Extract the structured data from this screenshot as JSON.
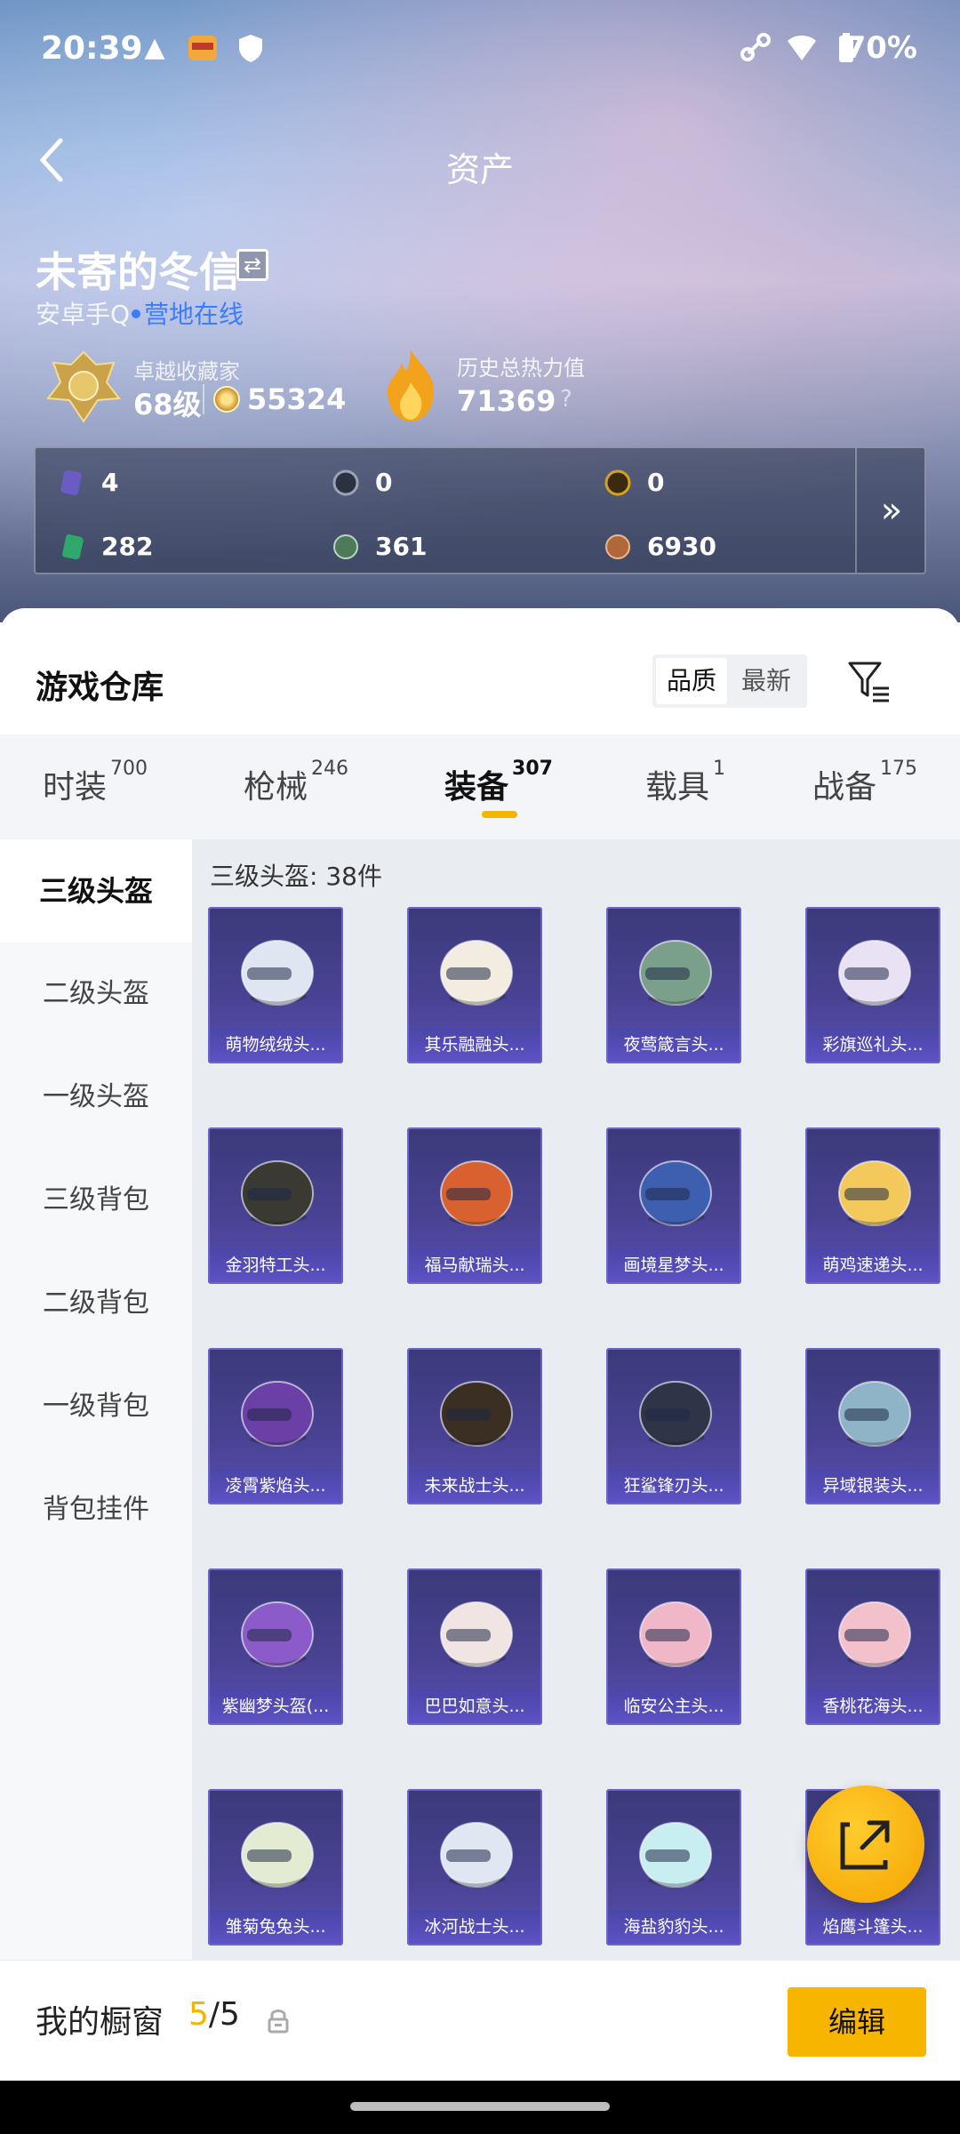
{
  "status_bar": {
    "time": "20:39",
    "battery": "70%"
  },
  "nav": {
    "title": "资产"
  },
  "player": {
    "name": "未寄的冬信",
    "platform": "安卓手Q",
    "status": "营地在线",
    "rank_title": "卓越收藏家",
    "level": "68级",
    "coins": "55324",
    "heat_title": "历史总热力值",
    "heat_value": "71369",
    "heat_help": "?"
  },
  "currencies": [
    {
      "icon": "card-icon",
      "value": "4",
      "color": "#6b5cc4"
    },
    {
      "icon": "ticket-icon",
      "value": "0",
      "color": "#7a8291"
    },
    {
      "icon": "gold-coin-icon",
      "value": "0",
      "color": "#d6a21e"
    },
    {
      "icon": "green-card-icon",
      "value": "282",
      "color": "#2fa86b"
    },
    {
      "icon": "green-orb-icon",
      "value": "361",
      "color": "#4f7a5a"
    },
    {
      "icon": "bronze-coin-icon",
      "value": "6930",
      "color": "#b0683a"
    }
  ],
  "warehouse": {
    "title": "游戏仓库",
    "sort_quality": "品质",
    "sort_newest": "最新"
  },
  "tabs": [
    {
      "label": "时装",
      "count": "700"
    },
    {
      "label": "枪械",
      "count": "246"
    },
    {
      "label": "装备",
      "count": "307"
    },
    {
      "label": "载具",
      "count": "1"
    },
    {
      "label": "战备",
      "count": "175"
    }
  ],
  "sidebar": {
    "items": [
      {
        "label": "三级头盔"
      },
      {
        "label": "二级头盔"
      },
      {
        "label": "一级头盔"
      },
      {
        "label": "三级背包"
      },
      {
        "label": "二级背包"
      },
      {
        "label": "一级背包"
      },
      {
        "label": "背包挂件"
      }
    ]
  },
  "content": {
    "section_label": "三级头盔: 38件",
    "items": [
      {
        "name": "萌物绒绒头...",
        "color": "#dfe6f2"
      },
      {
        "name": "其乐融融头...",
        "color": "#f3ece0"
      },
      {
        "name": "夜莺箴言头...",
        "color": "#7aa08b"
      },
      {
        "name": "彩旗巡礼头...",
        "color": "#e9e2f4"
      },
      {
        "name": "金羽特工头...",
        "color": "#3a3a33"
      },
      {
        "name": "福马献瑞头...",
        "color": "#d9612f"
      },
      {
        "name": "画境星梦头...",
        "color": "#3e5fb0"
      },
      {
        "name": "萌鸡速递头...",
        "color": "#f2c95a"
      },
      {
        "name": "凌霄紫焰头...",
        "color": "#6a3fa6"
      },
      {
        "name": "未来战士头...",
        "color": "#3b2e22"
      },
      {
        "name": "狂鲨锋刃头...",
        "color": "#2f3547"
      },
      {
        "name": "异域银装头...",
        "color": "#8fb4c8"
      },
      {
        "name": "紫幽梦头盔(...",
        "color": "#8a5bc9"
      },
      {
        "name": "巴巴如意头...",
        "color": "#f1e5e3"
      },
      {
        "name": "临安公主头...",
        "color": "#f0b7c8"
      },
      {
        "name": "香桃花海头...",
        "color": "#f3c1cc"
      },
      {
        "name": "雏菊兔兔头...",
        "color": "#e3ecd2"
      },
      {
        "name": "冰河战士头...",
        "color": "#dfe7f3"
      },
      {
        "name": "海盐豹豹头...",
        "color": "#c9eef2"
      },
      {
        "name": "焰鹰斗篷头...",
        "color": "#e8b7c6"
      }
    ]
  },
  "bottom_bar": {
    "label": "我的橱窗",
    "used": "5",
    "total": "5",
    "edit": "编辑"
  },
  "colors": {
    "accent": "#f4b400",
    "online": "#3b7cff"
  }
}
